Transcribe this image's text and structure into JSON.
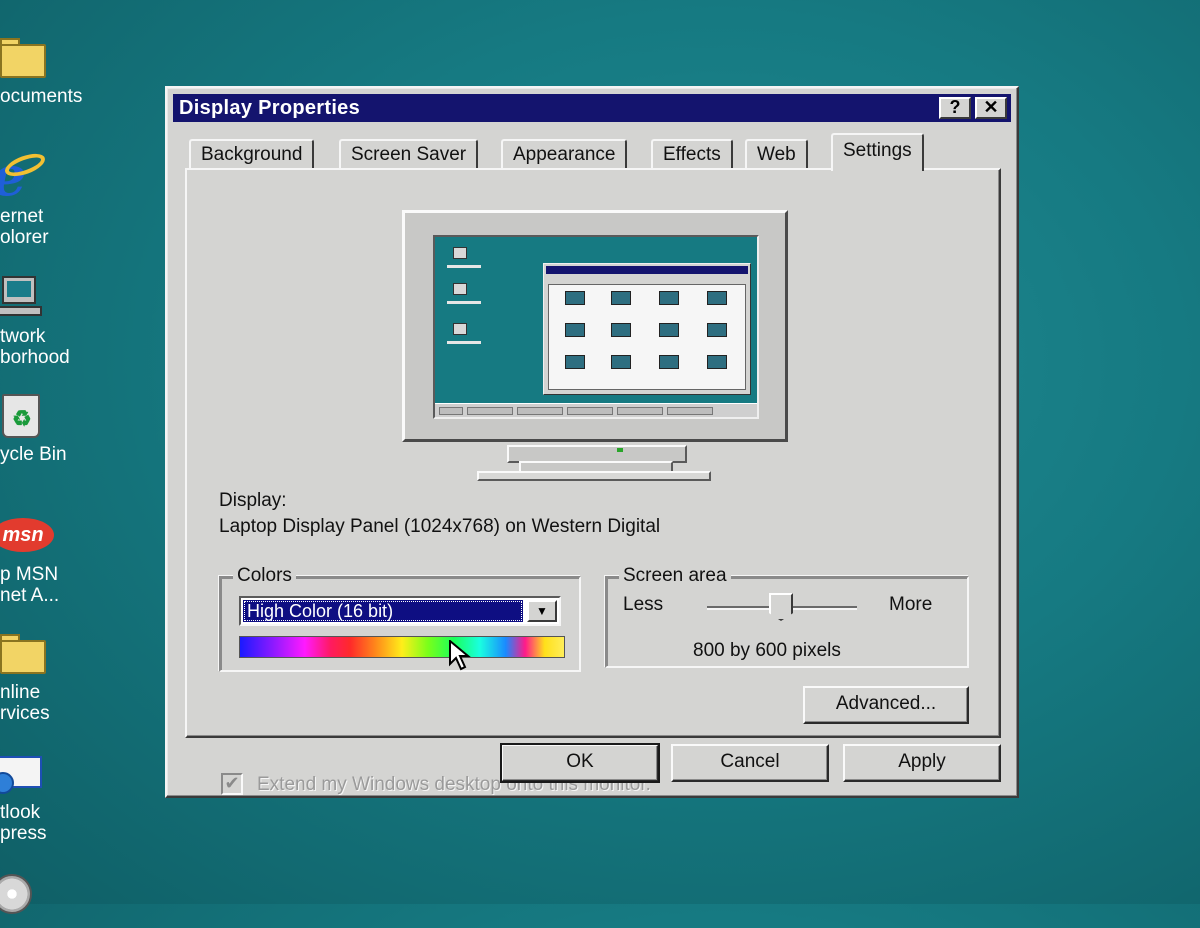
{
  "desktop": {
    "icons": [
      {
        "label": "ocuments",
        "label2": ""
      },
      {
        "label": "ernet",
        "label2": "olorer"
      },
      {
        "label": "twork",
        "label2": "borhood"
      },
      {
        "label": "ycle Bin",
        "label2": ""
      },
      {
        "label": "p MSN",
        "label2": "net A..."
      },
      {
        "label": "nline",
        "label2": "rvices"
      },
      {
        "label": "tlook",
        "label2": "press"
      }
    ],
    "msn_logo": "msn"
  },
  "dialog": {
    "title": "Display Properties",
    "help_label": "?",
    "close_label": "✕",
    "tabs": [
      "Background",
      "Screen Saver",
      "Appearance",
      "Effects",
      "Web",
      "Settings"
    ],
    "active_tab": "Settings",
    "display_label": "Display:",
    "display_value": "Laptop Display Panel (1024x768) on Western Digital",
    "colors": {
      "legend": "Colors",
      "selected": "High Color (16 bit)"
    },
    "screen_area": {
      "legend": "Screen area",
      "less_label": "Less",
      "more_label": "More",
      "value_text": "800 by 600 pixels"
    },
    "extend_checkbox": {
      "label": "Extend my Windows desktop onto this monitor.",
      "checked": true,
      "enabled": false
    },
    "advanced_button": "Advanced...",
    "ok_button": "OK",
    "cancel_button": "Cancel",
    "apply_button": "Apply"
  },
  "icons": {
    "help": "question-icon",
    "close": "close-icon",
    "dropdown": "chevron-down-icon",
    "checkmark": "check-icon",
    "pointer": "mouse-cursor-icon"
  },
  "colors": {
    "desktop": "#167a82",
    "titlebar": "#14146e",
    "dialog_face": "#d4d4d2",
    "selection": "#0e0e82"
  }
}
